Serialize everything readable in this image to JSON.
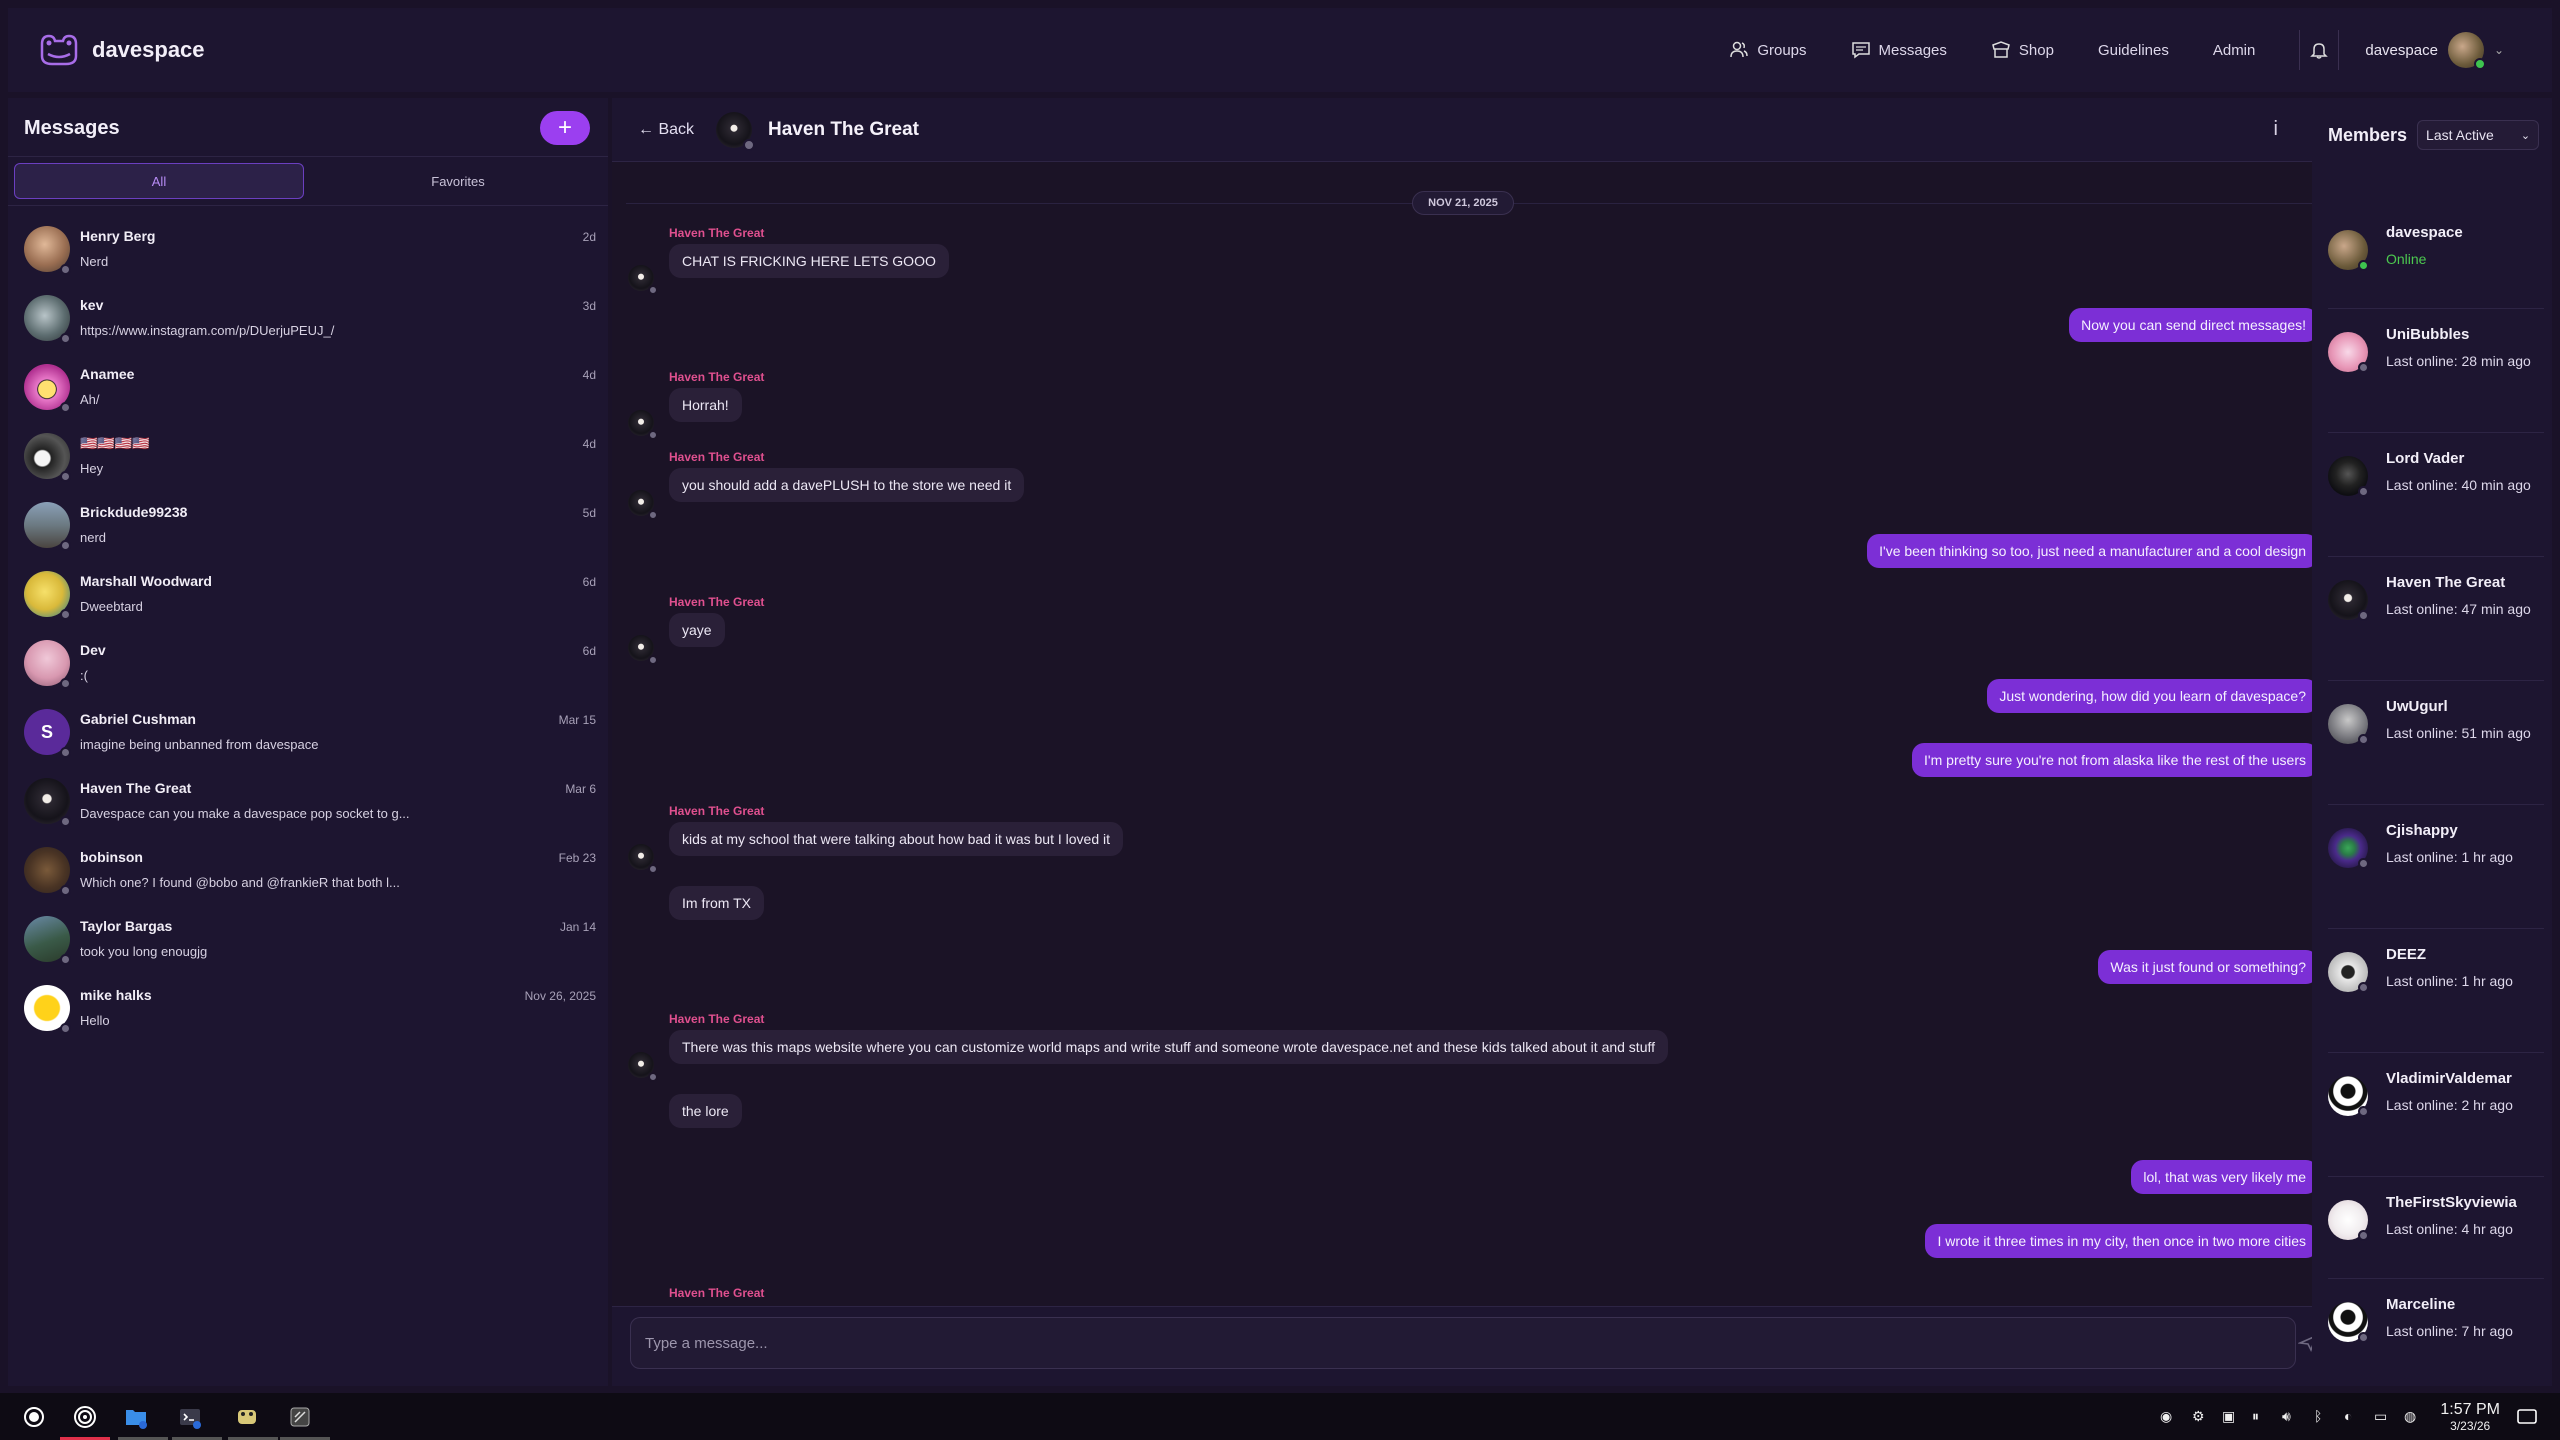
{
  "app": {
    "name": "davespace"
  },
  "nav": {
    "groups": "Groups",
    "messages": "Messages",
    "shop": "Shop",
    "guidelines": "Guidelines",
    "admin": "Admin",
    "username": "davespace"
  },
  "sidebar": {
    "title": "Messages",
    "new_button": "+",
    "tabs": [
      "All",
      "Favorites"
    ],
    "conversations": [
      {
        "name": "Henry Berg",
        "date": "2d",
        "preview": "Nerd"
      },
      {
        "name": "kev",
        "date": "3d",
        "preview": "https://www.instagram.com/p/DUerjuPEUJ_/"
      },
      {
        "name": "Anamee",
        "date": "4d",
        "preview": "Ah/"
      },
      {
        "name": "🇺🇸🇺🇸🇺🇸🇺🇸",
        "date": "4d",
        "preview": "Hey"
      },
      {
        "name": "Brickdude99238",
        "date": "5d",
        "preview": "nerd"
      },
      {
        "name": "Marshall Woodward",
        "date": "6d",
        "preview": "Dweebtard"
      },
      {
        "name": "Dev",
        "date": "6d",
        "preview": ":("
      },
      {
        "name": "Gabriel Cushman",
        "date": "Mar 15",
        "preview": "imagine being unbanned from davespace",
        "initial": "S"
      },
      {
        "name": "Haven The Great",
        "date": "Mar 6",
        "preview": "Davespace can you make a davespace pop socket to g..."
      },
      {
        "name": "bobinson",
        "date": "Feb 23",
        "preview": "Which one? I found @bobo and @frankieR that both l..."
      },
      {
        "name": "Taylor Bargas",
        "date": "Jan 14",
        "preview": "took you long enougjg"
      },
      {
        "name": "mike halks",
        "date": "Nov 26, 2025",
        "preview": "Hello"
      }
    ]
  },
  "chat": {
    "back_label": "← Back",
    "title": "Haven The Great",
    "info_label": "i",
    "date_divider": "NOV 21, 2025",
    "sender": "Haven The Great",
    "messages": [
      {
        "from": "them",
        "text": "CHAT IS FRICKING HERE LETS GOOO"
      },
      {
        "from": "me",
        "text": "Now you can send direct messages!"
      },
      {
        "from": "them",
        "text": "Horrah!"
      },
      {
        "from": "them",
        "text": "you should add a davePLUSH to the store we need it"
      },
      {
        "from": "me",
        "text": "I've been thinking so too, just need a manufacturer and a cool design"
      },
      {
        "from": "them",
        "text": "yaye"
      },
      {
        "from": "me",
        "text": "Just wondering, how did you learn of davespace?"
      },
      {
        "from": "me",
        "text": "I'm pretty sure you're not from alaska like the rest of the users"
      },
      {
        "from": "them",
        "text": "kids at my school that were talking about how bad it was but I loved it"
      },
      {
        "from": "them",
        "text": "Im from TX"
      },
      {
        "from": "me",
        "text": "Was it just found or something?"
      },
      {
        "from": "them",
        "text": "There was this maps website where you can customize world maps and write stuff and someone wrote davespace.net and these kids talked about it and stuff"
      },
      {
        "from": "them",
        "text": "the lore"
      },
      {
        "from": "me",
        "text": "lol, that was very likely me"
      },
      {
        "from": "me",
        "text": "I wrote it three times in my city, then once in two more cities"
      }
    ],
    "input_placeholder": "Type a message..."
  },
  "members": {
    "title": "Members",
    "sort_value": "Last Active",
    "list": [
      {
        "name": "davespace",
        "status": "Online"
      },
      {
        "name": "UniBubbles",
        "status": "Last online: 28 min ago"
      },
      {
        "name": "Lord Vader",
        "status": "Last online: 40 min ago"
      },
      {
        "name": "Haven The Great",
        "status": "Last online: 47 min ago"
      },
      {
        "name": "UwUgurl",
        "status": "Last online: 51 min ago"
      },
      {
        "name": "Cjishappy",
        "status": "Last online: 1 hr ago"
      },
      {
        "name": "DEEZ",
        "status": "Last online: 1 hr ago"
      },
      {
        "name": "VladimirValdemar",
        "status": "Last online: 2 hr ago"
      },
      {
        "name": "TheFirstSkyviewia",
        "status": "Last online: 4 hr ago"
      },
      {
        "name": "Marceline",
        "status": "Last online: 7 hr ago"
      }
    ]
  },
  "taskbar": {
    "time": "1:57 PM",
    "date": "3/23/26"
  },
  "colors": {
    "accent": "#7c2fd6",
    "plus_button": "#9b3ff0",
    "sender_name": "#e0508f",
    "online": "#3ec44f",
    "bg": "#1a1228"
  }
}
